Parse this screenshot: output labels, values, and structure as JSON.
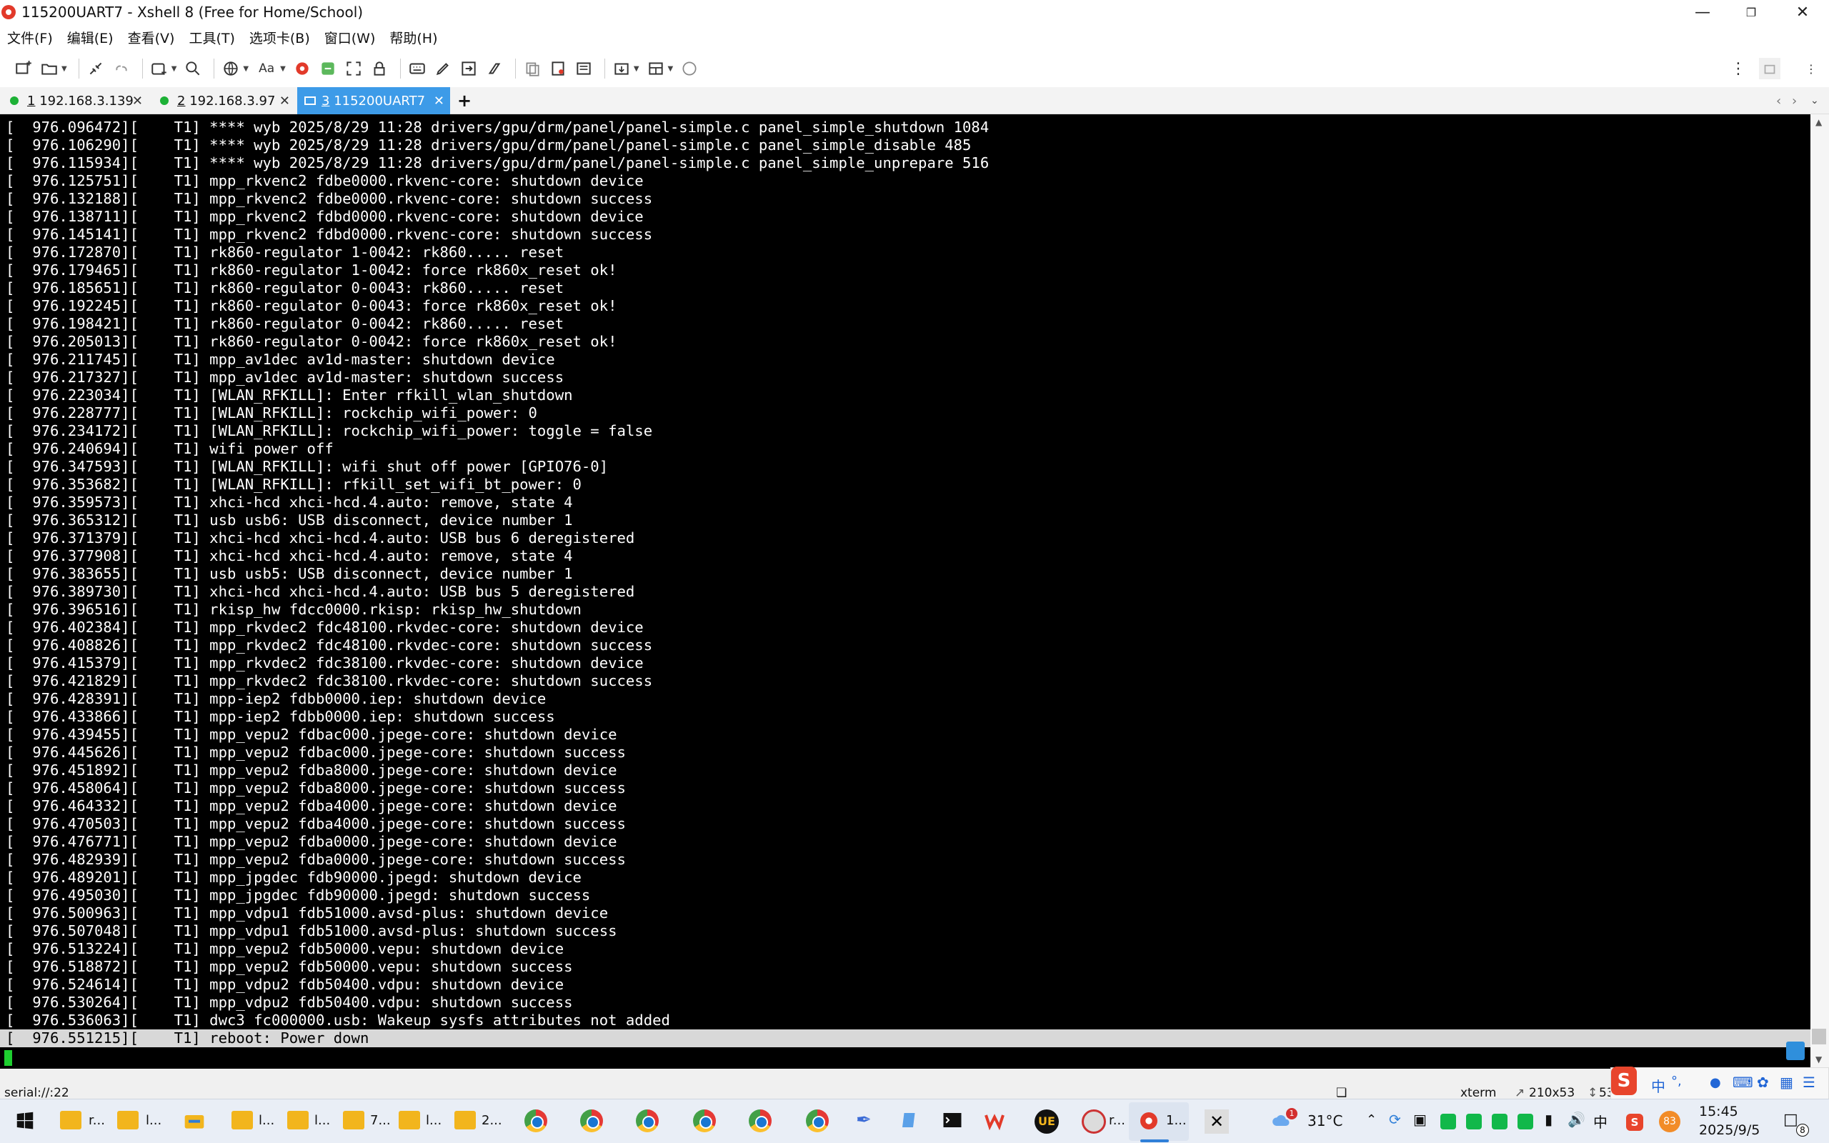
{
  "window": {
    "title": "115200UART7 - Xshell 8 (Free for Home/School)"
  },
  "menu": [
    "文件(F)",
    "编辑(E)",
    "查看(V)",
    "工具(T)",
    "选项卡(B)",
    "窗口(W)",
    "帮助(H)"
  ],
  "tabs": [
    {
      "num": "1",
      "label": "192.168.3.139",
      "status": "connected"
    },
    {
      "num": "2",
      "label": "192.168.3.97",
      "status": "connected"
    },
    {
      "num": "3",
      "label": "115200UART7",
      "status": "active"
    }
  ],
  "terminal": {
    "lines": [
      "[  976.096472][    T1] **** wyb 2025/8/29 11:28 drivers/gpu/drm/panel/panel-simple.c panel_simple_shutdown 1084",
      "[  976.106290][    T1] **** wyb 2025/8/29 11:28 drivers/gpu/drm/panel/panel-simple.c panel_simple_disable 485",
      "[  976.115934][    T1] **** wyb 2025/8/29 11:28 drivers/gpu/drm/panel/panel-simple.c panel_simple_unprepare 516",
      "[  976.125751][    T1] mpp_rkvenc2 fdbe0000.rkvenc-core: shutdown device",
      "[  976.132188][    T1] mpp_rkvenc2 fdbe0000.rkvenc-core: shutdown success",
      "[  976.138711][    T1] mpp_rkvenc2 fdbd0000.rkvenc-core: shutdown device",
      "[  976.145141][    T1] mpp_rkvenc2 fdbd0000.rkvenc-core: shutdown success",
      "[  976.172870][    T1] rk860-regulator 1-0042: rk860..... reset",
      "[  976.179465][    T1] rk860-regulator 1-0042: force rk860x_reset ok!",
      "[  976.185651][    T1] rk860-regulator 0-0043: rk860..... reset",
      "[  976.192245][    T1] rk860-regulator 0-0043: force rk860x_reset ok!",
      "[  976.198421][    T1] rk860-regulator 0-0042: rk860..... reset",
      "[  976.205013][    T1] rk860-regulator 0-0042: force rk860x_reset ok!",
      "[  976.211745][    T1] mpp_av1dec av1d-master: shutdown device",
      "[  976.217327][    T1] mpp_av1dec av1d-master: shutdown success",
      "[  976.223034][    T1] [WLAN_RFKILL]: Enter rfkill_wlan_shutdown",
      "[  976.228777][    T1] [WLAN_RFKILL]: rockchip_wifi_power: 0",
      "[  976.234172][    T1] [WLAN_RFKILL]: rockchip_wifi_power: toggle = false",
      "[  976.240694][    T1] wifi power off",
      "[  976.347593][    T1] [WLAN_RFKILL]: wifi shut off power [GPIO76-0]",
      "[  976.353682][    T1] [WLAN_RFKILL]: rfkill_set_wifi_bt_power: 0",
      "[  976.359573][    T1] xhci-hcd xhci-hcd.4.auto: remove, state 4",
      "[  976.365312][    T1] usb usb6: USB disconnect, device number 1",
      "[  976.371379][    T1] xhci-hcd xhci-hcd.4.auto: USB bus 6 deregistered",
      "[  976.377908][    T1] xhci-hcd xhci-hcd.4.auto: remove, state 4",
      "[  976.383655][    T1] usb usb5: USB disconnect, device number 1",
      "[  976.389730][    T1] xhci-hcd xhci-hcd.4.auto: USB bus 5 deregistered",
      "[  976.396516][    T1] rkisp_hw fdcc0000.rkisp: rkisp_hw_shutdown",
      "[  976.402384][    T1] mpp_rkvdec2 fdc48100.rkvdec-core: shutdown device",
      "[  976.408826][    T1] mpp_rkvdec2 fdc48100.rkvdec-core: shutdown success",
      "[  976.415379][    T1] mpp_rkvdec2 fdc38100.rkvdec-core: shutdown device",
      "[  976.421829][    T1] mpp_rkvdec2 fdc38100.rkvdec-core: shutdown success",
      "[  976.428391][    T1] mpp-iep2 fdbb0000.iep: shutdown device",
      "[  976.433866][    T1] mpp-iep2 fdbb0000.iep: shutdown success",
      "[  976.439455][    T1] mpp_vepu2 fdbac000.jpege-core: shutdown device",
      "[  976.445626][    T1] mpp_vepu2 fdbac000.jpege-core: shutdown success",
      "[  976.451892][    T1] mpp_vepu2 fdba8000.jpege-core: shutdown device",
      "[  976.458064][    T1] mpp_vepu2 fdba8000.jpege-core: shutdown success",
      "[  976.464332][    T1] mpp_vepu2 fdba4000.jpege-core: shutdown device",
      "[  976.470503][    T1] mpp_vepu2 fdba4000.jpege-core: shutdown success",
      "[  976.476771][    T1] mpp_vepu2 fdba0000.jpege-core: shutdown device",
      "[  976.482939][    T1] mpp_vepu2 fdba0000.jpege-core: shutdown success",
      "[  976.489201][    T1] mpp_jpgdec fdb90000.jpegd: shutdown device",
      "[  976.495030][    T1] mpp_jpgdec fdb90000.jpegd: shutdown success",
      "[  976.500963][    T1] mpp_vdpu1 fdb51000.avsd-plus: shutdown device",
      "[  976.507048][    T1] mpp_vdpu1 fdb51000.avsd-plus: shutdown success",
      "[  976.513224][    T1] mpp_vepu2 fdb50000.vepu: shutdown device",
      "[  976.518872][    T1] mpp_vepu2 fdb50000.vepu: shutdown success",
      "[  976.524614][    T1] mpp_vdpu2 fdb50400.vdpu: shutdown device",
      "[  976.530264][    T1] mpp_vdpu2 fdb50400.vdpu: shutdown success",
      "[  976.536063][    T1] dwc3 fc000000.usb: Wakeup sysfs attributes not added"
    ],
    "highlighted_line": "[  976.551215][    T1] reboot: Power down"
  },
  "statusbar": {
    "connection": "serial://:22",
    "terminal_type": "xterm",
    "size": "210x53",
    "cursor_pos": "53,"
  },
  "taskbar": {
    "items": [
      "r...",
      "l...",
      "l...",
      "l...",
      "7...",
      "l...",
      "2...",
      "r...",
      "1..."
    ],
    "weather_badge": "1",
    "temperature": "31°C",
    "ime": "中",
    "ime_punct": "°,",
    "wps_badge": "83",
    "time": "15:45",
    "date": "2025/9/5",
    "notifications": "8"
  }
}
